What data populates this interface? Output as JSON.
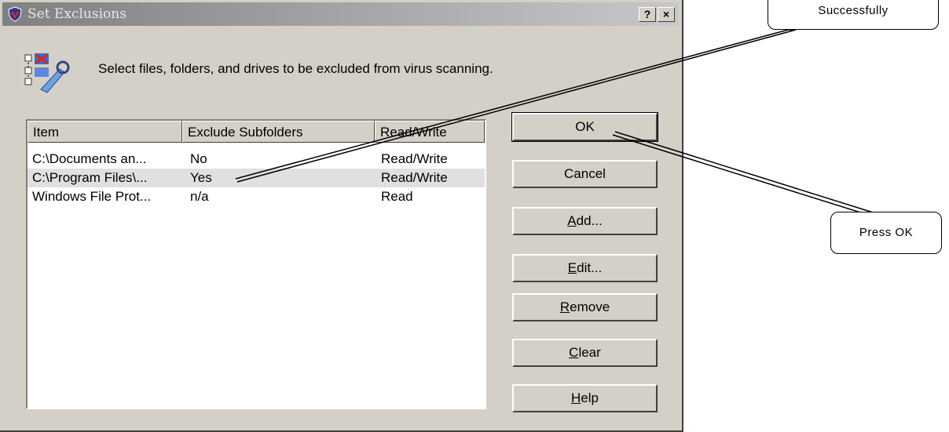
{
  "window": {
    "title": "Set Exclusions",
    "help_button": "?",
    "close_button": "×",
    "description": "Select files, folders, and drives to be excluded from virus scanning."
  },
  "list": {
    "columns": [
      "Item",
      "Exclude Subfolders",
      "Read/Write"
    ],
    "rows": [
      {
        "item": "C:\\Documents an...",
        "subfolders": "No",
        "access": "Read/Write"
      },
      {
        "item": "C:\\Program Files\\...",
        "subfolders": "Yes",
        "access": "Read/Write"
      },
      {
        "item": "Windows File Prot...",
        "subfolders": "n/a",
        "access": "Read"
      }
    ],
    "selected_index": 1
  },
  "buttons": {
    "ok": "OK",
    "cancel": "Cancel",
    "add": {
      "mnemonic": "A",
      "rest": "dd..."
    },
    "edit": {
      "mnemonic": "E",
      "rest": "dit..."
    },
    "remove": {
      "mnemonic": "R",
      "rest": "emove"
    },
    "clear": {
      "mnemonic": "C",
      "rest": "lear"
    },
    "help": {
      "mnemonic": "H",
      "rest": "elp"
    }
  },
  "callouts": {
    "top": "Successfully",
    "ok": "Press OK"
  },
  "colors": {
    "dialog_bg": "#d4d0c8",
    "titlebar_inactive": "#808080",
    "selection_bg": "#e0e0e0"
  },
  "icons": [
    "shield-icon",
    "exclusion-tools-icon"
  ]
}
